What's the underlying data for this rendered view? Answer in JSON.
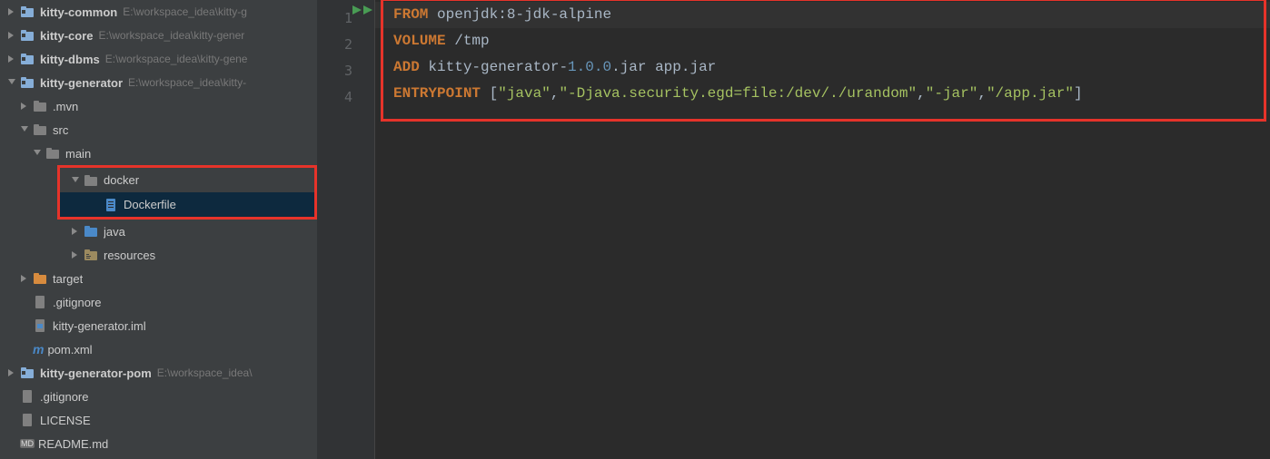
{
  "tree": {
    "kitty_common": {
      "name": "kitty-common",
      "path": "E:\\workspace_idea\\kitty-g"
    },
    "kitty_core": {
      "name": "kitty-core",
      "path": "E:\\workspace_idea\\kitty-gener"
    },
    "kitty_dbms": {
      "name": "kitty-dbms",
      "path": "E:\\workspace_idea\\kitty-gene"
    },
    "kitty_generator": {
      "name": "kitty-generator",
      "path": "E:\\workspace_idea\\kitty-"
    },
    "mvn": ".mvn",
    "src": "src",
    "main": "main",
    "docker": "docker",
    "dockerfile": "Dockerfile",
    "java": "java",
    "resources": "resources",
    "target": "target",
    "gitignore1": ".gitignore",
    "iml": "kitty-generator.iml",
    "pom": "pom.xml",
    "kitty_generator_pom": {
      "name": "kitty-generator-pom",
      "path": "E:\\workspace_idea\\"
    },
    "gitignore2": ".gitignore",
    "license": "LICENSE",
    "readme": "README.md"
  },
  "editor": {
    "lines": [
      "1",
      "2",
      "3",
      "4"
    ],
    "l1_kw": "FROM",
    "l1_rest": " openjdk:8-jdk-alpine",
    "l2_kw": "VOLUME",
    "l2_rest": " /tmp",
    "l3_kw": "ADD",
    "l3_a": " kitty-generator-",
    "l3_v": "1.0.0",
    "l3_b": ".jar app.jar",
    "l4_kw": "ENTRYPOINT",
    "l4_a": " [",
    "l4_s1": "\"java\"",
    "l4_c1": ",",
    "l4_s2": "\"-Djava.security.egd=file:/dev/./urandom\"",
    "l4_c2": ",",
    "l4_s3": "\"-jar\"",
    "l4_c3": ",",
    "l4_s4": "\"/app.jar\"",
    "l4_b": "]"
  }
}
